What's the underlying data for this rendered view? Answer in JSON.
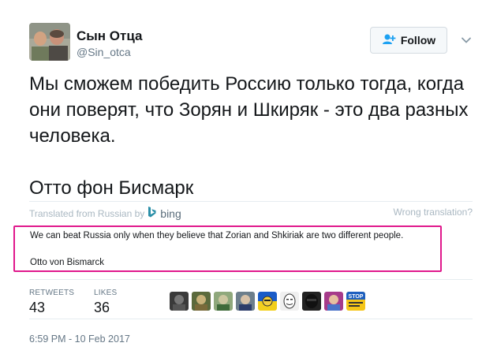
{
  "author": {
    "display_name": "Сын Отца",
    "handle": "@Sin_otca"
  },
  "follow": {
    "label": "Follow"
  },
  "tweet": {
    "text": "Мы сможем победить Россию только тогда, когда они поверят, что Зорян и Шкиряк - это два разных человека.",
    "signature": "Отто фон Бисмарк"
  },
  "translation": {
    "source_label": "Translated from Russian by",
    "provider": "bing",
    "wrong_label": "Wrong translation?",
    "text": "We can beat Russia only when they believe that Zorian and Shkiriak are two different people.",
    "signature": "Otto von Bismarck"
  },
  "stats": {
    "retweets_label": "RETWEETS",
    "retweets": "43",
    "likes_label": "LIKES",
    "likes": "36"
  },
  "liker_avatars": [
    {
      "name": "liker-avatar-1"
    },
    {
      "name": "liker-avatar-2"
    },
    {
      "name": "liker-avatar-3"
    },
    {
      "name": "liker-avatar-4"
    },
    {
      "name": "liker-avatar-5"
    },
    {
      "name": "liker-avatar-6"
    },
    {
      "name": "liker-avatar-7"
    },
    {
      "name": "liker-avatar-8"
    },
    {
      "name": "liker-avatar-9"
    }
  ],
  "stop_badge": {
    "text": "STOP"
  },
  "timestamp": "6:59 PM - 10 Feb 2017",
  "colors": {
    "highlight_border": "#e0188c",
    "bing_icon": "#2a8fa8"
  }
}
